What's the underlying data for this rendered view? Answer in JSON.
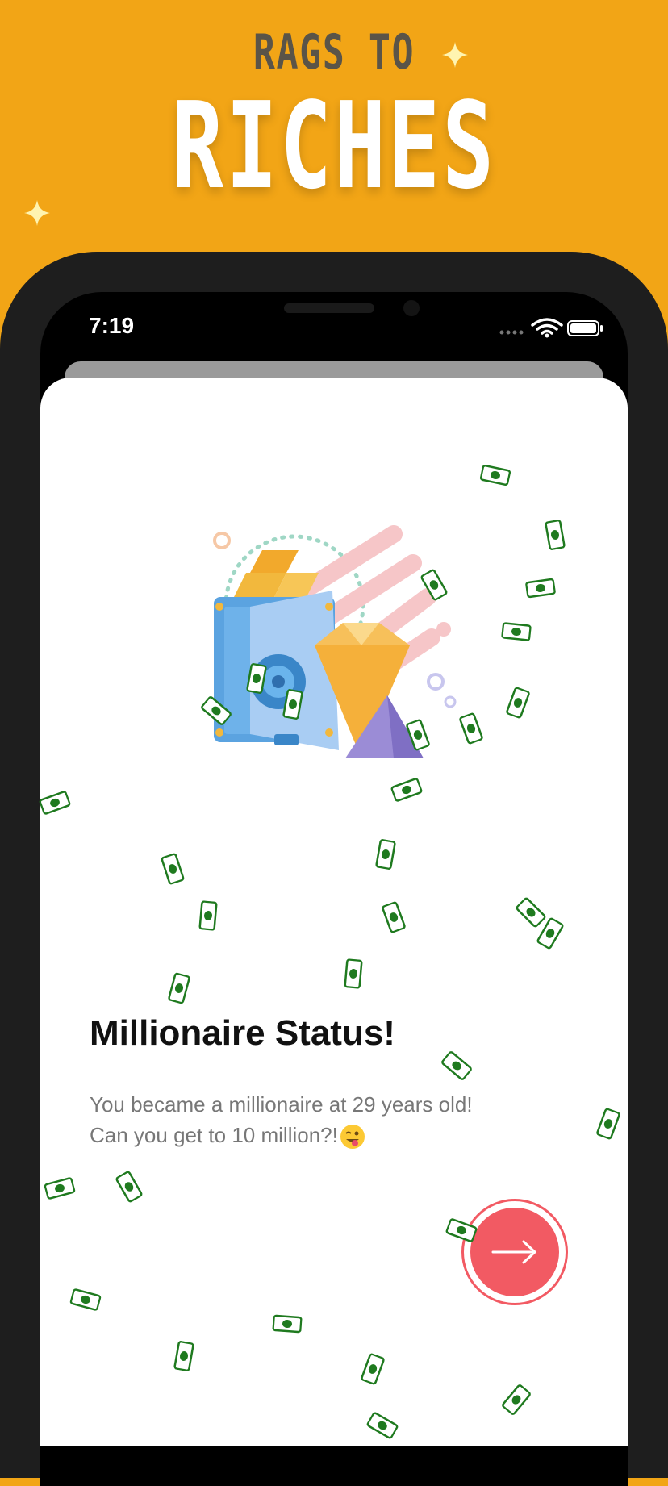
{
  "promo": {
    "tagline_top": "RAGS TO",
    "tagline_main": "RICHES"
  },
  "status_bar": {
    "time": "7:19",
    "icons": [
      "signal-dots-icon",
      "wifi-icon",
      "battery-icon"
    ]
  },
  "achievement": {
    "title": "Millionaire Status!",
    "body_line1": "You became a millionaire at 29 years old!",
    "body_line2": "Can you get to 10 million?!",
    "emoji": "winking-face-with-tongue-icon"
  },
  "next_button": {
    "icon": "arrow-right-icon"
  },
  "colors": {
    "background": "#f2a516",
    "accent": "#f25a63",
    "money_green": "#1f7a1f"
  }
}
